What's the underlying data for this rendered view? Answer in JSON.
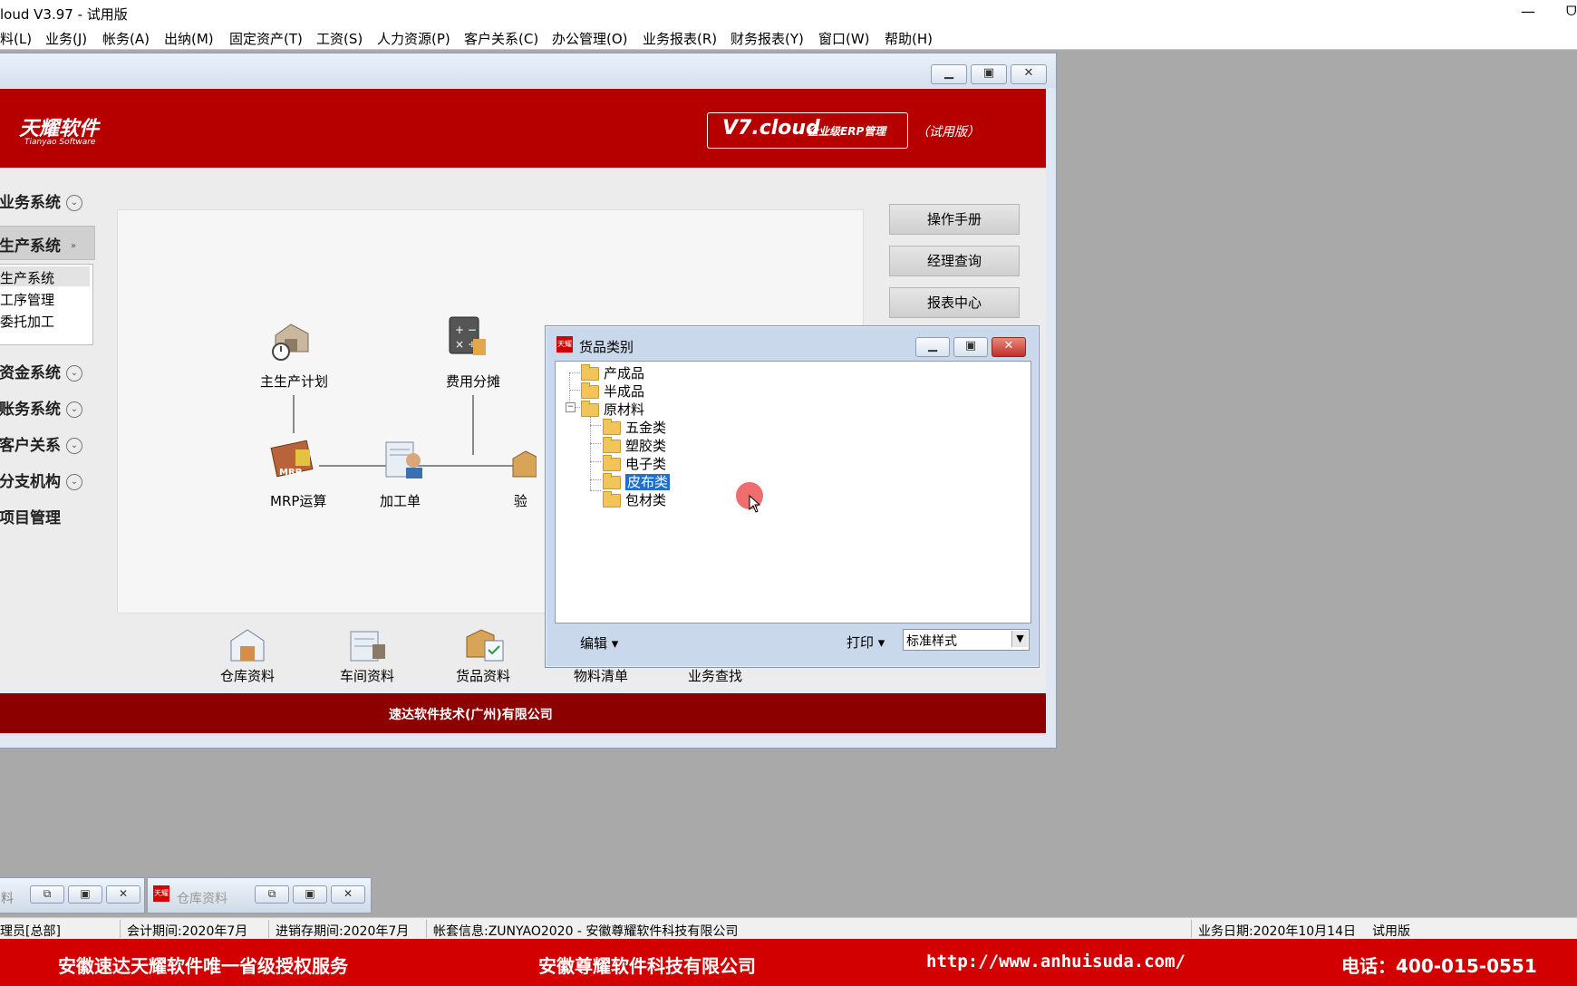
{
  "app": {
    "title": "loud V3.97 - 试用版",
    "minimize_glyph": "—",
    "restore_glyph": "ᗜ"
  },
  "menu": [
    "料(L)",
    "业务(J)",
    "帐务(A)",
    "出纳(M)",
    "固定资产(T)",
    "工资(S)",
    "人力资源(P)",
    "客户关系(C)",
    "办公管理(O)",
    "业务报表(R)",
    "财务报表(Y)",
    "窗口(W)",
    "帮助(H)"
  ],
  "banner": {
    "logo": "天耀软件",
    "logo_sub": "Tianyao Software",
    "v7": "V7.cloud",
    "v7_sub": "企业级ERP管理",
    "edition": "（试用版）"
  },
  "nav": {
    "groups": [
      "业务系统",
      "生产系统",
      "资金系统",
      "账务系统",
      "客户关系",
      "分支机构",
      "项目管理"
    ],
    "sub_items": [
      "生产系统",
      "工序管理",
      "委托加工"
    ]
  },
  "flow": {
    "labels": [
      "主生产计划",
      "费用分摊",
      "MRP运算",
      "加工单",
      "验收"
    ]
  },
  "right_buttons": [
    "操作手册",
    "经理查询",
    "报表中心"
  ],
  "bottom_items": [
    "仓库资料",
    "车间资料",
    "货品资料",
    "物料清单",
    "业务查找"
  ],
  "footer": "速达软件技术(广州)有限公司",
  "dialog": {
    "title": "货品类别",
    "icon_text": "天耀",
    "tree": {
      "root_items": [
        "产成品",
        "半成品",
        "原材料"
      ],
      "children": [
        "五金类",
        "塑胶类",
        "电子类",
        "皮布类",
        "包材类"
      ],
      "selected": "皮布类"
    },
    "edit_label": "编辑",
    "print_label": "打印",
    "style_select": "标准样式"
  },
  "minimized": {
    "first_label": "料",
    "second_label": "仓库资料"
  },
  "status": {
    "operator": "理员[总部]",
    "period": "会计期间:2020年7月",
    "inventory_period": "进销存期间:2020年7月",
    "account_info": "帐套信息:ZUNYAO2020 - 安徽尊耀软件科技有限公司",
    "business_date": "业务日期:2020年10月14日",
    "mode": "试用版"
  },
  "promo": {
    "left": "安徽速达天耀软件唯一省级授权服务",
    "middle": "安徽尊耀软件科技有限公司",
    "url": "http://www.anhuisuda.com/",
    "phone": "电话：400-015-0551"
  },
  "colors": {
    "banner_red": "#b60000",
    "footer_red": "#8c0000",
    "promo_red": "#d20000",
    "selection_blue": "#1e6fd0"
  }
}
